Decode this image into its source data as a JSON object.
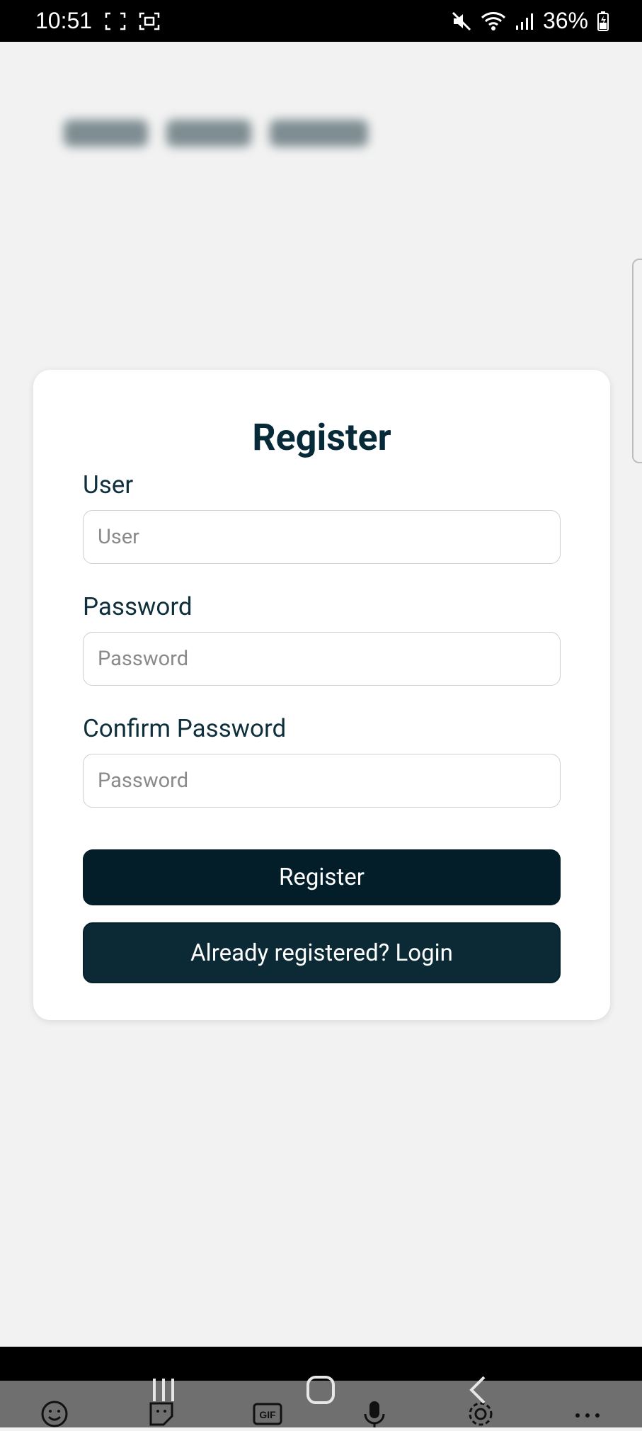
{
  "status_bar": {
    "time": "10:51",
    "battery": "36%",
    "icons": [
      "screenshot-frame-icon",
      "screen-record-icon",
      "mute-icon",
      "wifi-icon",
      "signal-icon",
      "battery-icon"
    ]
  },
  "card": {
    "title": "Register",
    "fields": [
      {
        "label": "User",
        "placeholder": "User",
        "value": ""
      },
      {
        "label": "Password",
        "placeholder": "Password",
        "value": ""
      },
      {
        "label": "Confirm Password",
        "placeholder": "Password",
        "value": ""
      }
    ],
    "register_button": "Register",
    "login_button": "Already registered? Login"
  },
  "nav_bar": {
    "icons": [
      "recent-apps-icon",
      "home-icon",
      "back-icon"
    ]
  },
  "keyboard_toolbar": {
    "icons": [
      "emoji-icon",
      "sticker-icon",
      "gif-icon",
      "microphone-icon",
      "settings-icon",
      "more-icon"
    ],
    "gif_label": "GIF"
  },
  "colors": {
    "primary_dark": "#031e28",
    "secondary_dark": "#0c2a35",
    "title": "#062a38",
    "background": "#f2f2f2"
  }
}
